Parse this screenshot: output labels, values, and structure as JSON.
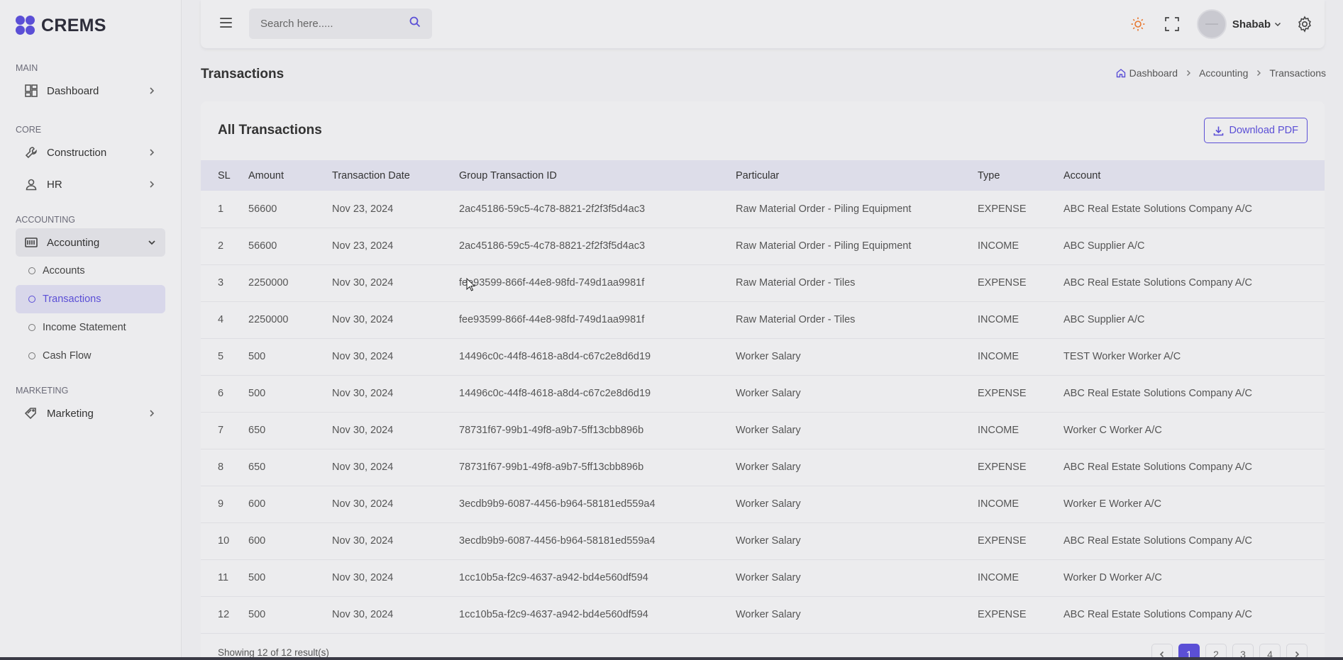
{
  "brand": {
    "name": "CREMS"
  },
  "sidebar": {
    "sections": {
      "main": "MAIN",
      "core": "CORE",
      "accounting": "ACCOUNTING",
      "marketing": "MARKETING"
    },
    "items": {
      "dashboard": "Dashboard",
      "construction": "Construction",
      "hr": "HR",
      "accounting": "Accounting",
      "marketing": "Marketing"
    },
    "accounting_sub": {
      "accounts": "Accounts",
      "transactions": "Transactions",
      "income_statement": "Income Statement",
      "cash_flow": "Cash Flow"
    }
  },
  "topbar": {
    "search_placeholder": "Search here.....",
    "username": "Shabab"
  },
  "page": {
    "title": "Transactions",
    "breadcrumb": [
      "Dashboard",
      "Accounting",
      "Transactions"
    ]
  },
  "card": {
    "title": "All Transactions",
    "download_label": "Download PDF"
  },
  "table": {
    "headers": [
      "SL",
      "Amount",
      "Transaction Date",
      "Group Transaction ID",
      "Particular",
      "Type",
      "Account"
    ],
    "rows": [
      [
        "1",
        "56600",
        "Nov 23, 2024",
        "2ac45186-59c5-4c78-8821-2f2f3f5d4ac3",
        "Raw Material Order - Piling Equipment",
        "EXPENSE",
        "ABC Real Estate Solutions Company A/C"
      ],
      [
        "2",
        "56600",
        "Nov 23, 2024",
        "2ac45186-59c5-4c78-8821-2f2f3f5d4ac3",
        "Raw Material Order - Piling Equipment",
        "INCOME",
        "ABC Supplier A/C"
      ],
      [
        "3",
        "2250000",
        "Nov 30, 2024",
        "fee93599-866f-44e8-98fd-749d1aa9981f",
        "Raw Material Order - Tiles",
        "EXPENSE",
        "ABC Real Estate Solutions Company A/C"
      ],
      [
        "4",
        "2250000",
        "Nov 30, 2024",
        "fee93599-866f-44e8-98fd-749d1aa9981f",
        "Raw Material Order - Tiles",
        "INCOME",
        "ABC Supplier A/C"
      ],
      [
        "5",
        "500",
        "Nov 30, 2024",
        "14496c0c-44f8-4618-a8d4-c67c2e8d6d19",
        "Worker Salary",
        "INCOME",
        "TEST Worker Worker A/C"
      ],
      [
        "6",
        "500",
        "Nov 30, 2024",
        "14496c0c-44f8-4618-a8d4-c67c2e8d6d19",
        "Worker Salary",
        "EXPENSE",
        "ABC Real Estate Solutions Company A/C"
      ],
      [
        "7",
        "650",
        "Nov 30, 2024",
        "78731f67-99b1-49f8-a9b7-5ff13cbb896b",
        "Worker Salary",
        "INCOME",
        "Worker C Worker A/C"
      ],
      [
        "8",
        "650",
        "Nov 30, 2024",
        "78731f67-99b1-49f8-a9b7-5ff13cbb896b",
        "Worker Salary",
        "EXPENSE",
        "ABC Real Estate Solutions Company A/C"
      ],
      [
        "9",
        "600",
        "Nov 30, 2024",
        "3ecdb9b9-6087-4456-b964-58181ed559a4",
        "Worker Salary",
        "INCOME",
        "Worker E Worker A/C"
      ],
      [
        "10",
        "600",
        "Nov 30, 2024",
        "3ecdb9b9-6087-4456-b964-58181ed559a4",
        "Worker Salary",
        "EXPENSE",
        "ABC Real Estate Solutions Company A/C"
      ],
      [
        "11",
        "500",
        "Nov 30, 2024",
        "1cc10b5a-f2c9-4637-a942-bd4e560df594",
        "Worker Salary",
        "INCOME",
        "Worker D Worker A/C"
      ],
      [
        "12",
        "500",
        "Nov 30, 2024",
        "1cc10b5a-f2c9-4637-a942-bd4e560df594",
        "Worker Salary",
        "EXPENSE",
        "ABC Real Estate Solutions Company A/C"
      ]
    ]
  },
  "footer": {
    "showing_text": "Showing 12 of 12 result(s)",
    "pages": [
      "1",
      "2",
      "3",
      "4"
    ],
    "active_page": "1"
  },
  "colors": {
    "accent": "#5b4fd6",
    "sun_icon": "#e8772e"
  },
  "icons": {
    "menu": "hamburger-icon",
    "search": "search-icon",
    "theme": "sun-icon",
    "fullscreen": "fullscreen-icon",
    "settings": "gear-icon",
    "download": "download-icon"
  }
}
